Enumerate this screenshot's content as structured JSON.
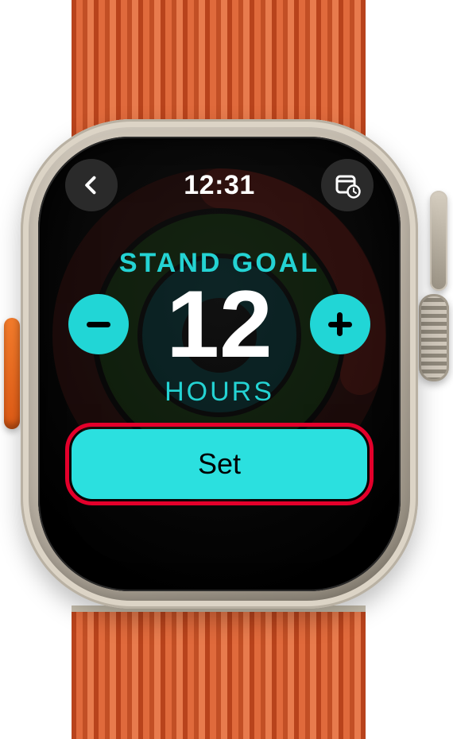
{
  "status": {
    "time": "12:31"
  },
  "nav": {
    "back_icon_name": "chevron-left-icon",
    "calendar_icon_name": "calendar-clock-icon"
  },
  "goal": {
    "title": "STAND GOAL",
    "value": "12",
    "unit": "HOURS"
  },
  "controls": {
    "decrement_label": "−",
    "increment_label": "+",
    "set_label": "Set"
  },
  "colors": {
    "accent": "#21d6d6",
    "highlight_border": "#e4002b"
  }
}
